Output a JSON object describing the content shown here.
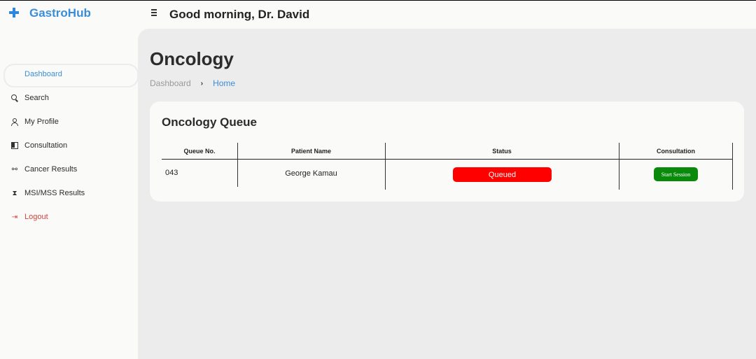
{
  "app": {
    "brand": "GastroHub",
    "greeting": "Good morning, Dr. David"
  },
  "sidebar": {
    "items": [
      {
        "label": "Dashboard",
        "icon": "dashboard-icon",
        "active": true
      },
      {
        "label": "Search",
        "icon": "search-icon"
      },
      {
        "label": "My Profile",
        "icon": "user-icon"
      },
      {
        "label": "Consultation",
        "icon": "consultation-icon"
      },
      {
        "label": "Cancer Results",
        "icon": "link-icon"
      },
      {
        "label": "MSI/MSS Results",
        "icon": "hourglass-icon"
      },
      {
        "label": "Logout",
        "icon": "logout-icon"
      }
    ]
  },
  "main": {
    "title": "Oncology",
    "breadcrumb": [
      "Dashboard",
      "Home"
    ]
  },
  "queue": {
    "title": "Oncology Queue",
    "columns": [
      "Queue No.",
      "Patient Name",
      "Status",
      "Consultation"
    ],
    "rows": [
      {
        "queue_no": "043",
        "patient": "George Kamau",
        "status": "Queued",
        "action": "Start Session"
      }
    ]
  },
  "colors": {
    "accent": "#3a8ed8",
    "status_queued": "#ff0000",
    "action_button": "#0a8a0a",
    "logout": "#d9413b"
  }
}
